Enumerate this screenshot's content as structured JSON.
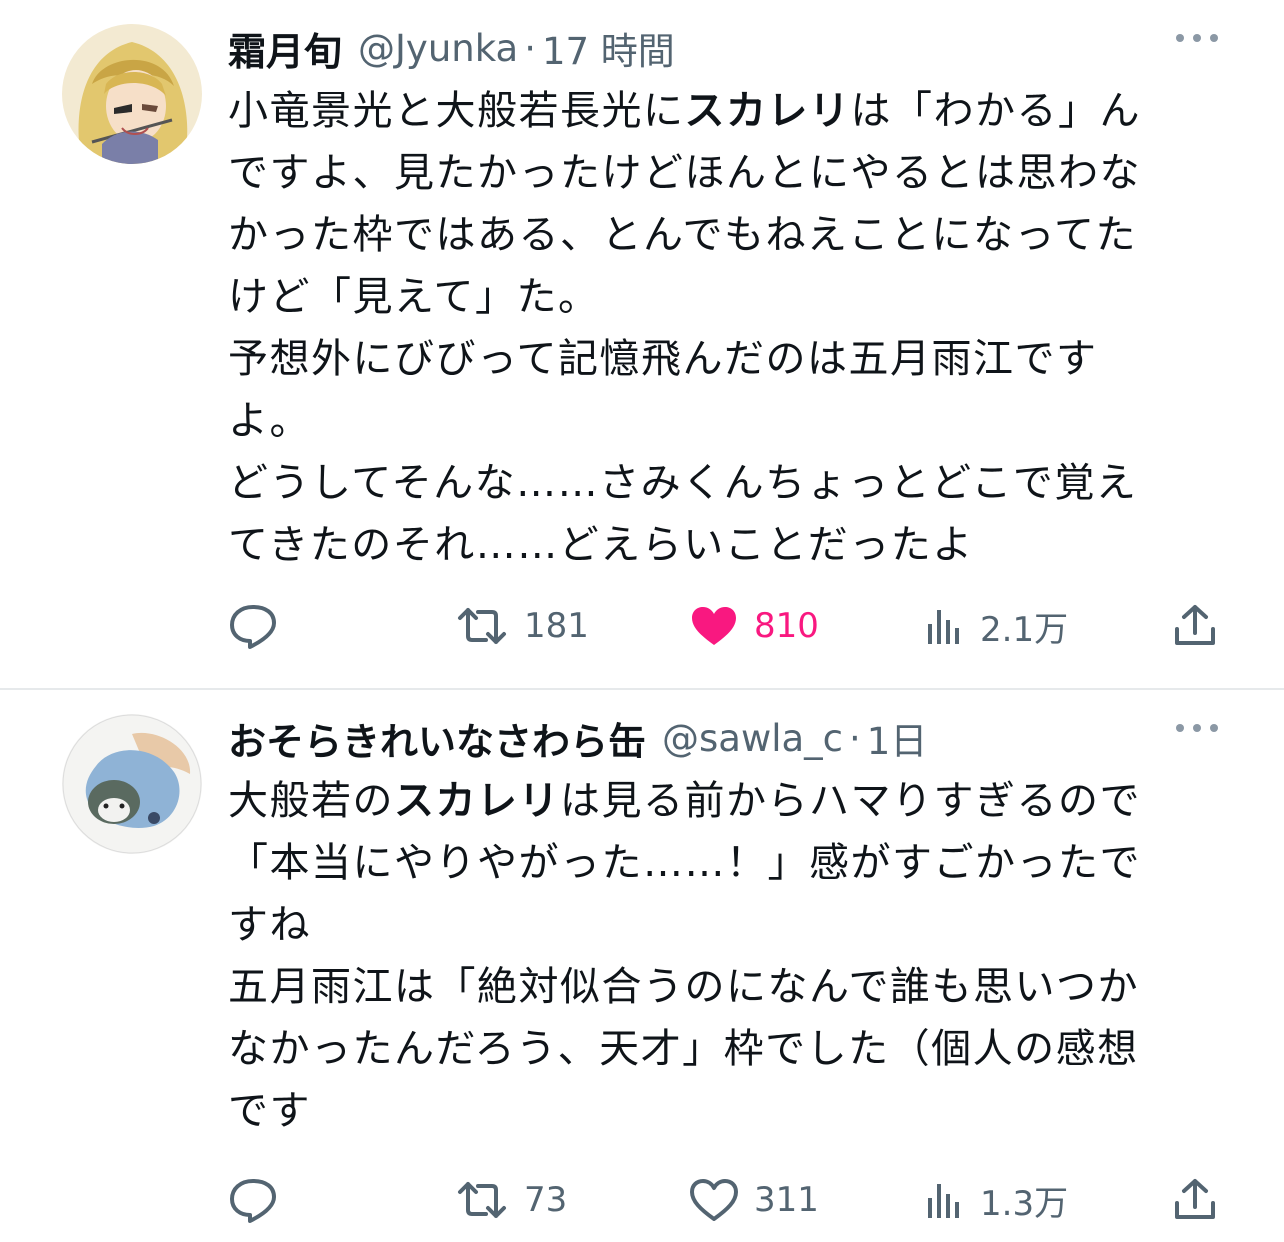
{
  "tweets": [
    {
      "name": "霜月旬",
      "handle": "@Jyunka",
      "separator": "·",
      "time": "17 時間",
      "lines": [
        [
          "小竜景光と大般若長光に",
          "スカレリ",
          "は「わかる」ん"
        ],
        [
          "ですよ、見たかったけどほんとにやるとは思わな"
        ],
        [
          "かった枠ではある、とんでもねえことになってた"
        ],
        [
          "けど「見えて」た。"
        ],
        [
          "予想外にびびって記憶飛んだのは五月雨江です"
        ],
        [
          "よ。"
        ],
        [
          "どうしてそんな……さみくんちょっとどこで覚え"
        ],
        [
          "てきたのそれ……どえらいことだったよ"
        ]
      ],
      "retweets": "181",
      "likes": "810",
      "liked": true,
      "views": "2.1万"
    },
    {
      "name": "おそらきれいなさわら缶",
      "handle": "@sawla_c",
      "separator": "·",
      "time": "1日",
      "lines": [
        [
          "大般若の",
          "スカレリ",
          "は見る前からハマりすぎるので"
        ],
        [
          "「本当にやりやがった……！」感がすごかったで"
        ],
        [
          "すね"
        ],
        [
          "五月雨江は「絶対似合うのになんで誰も思いつか"
        ],
        [
          "なかったんだろう、天才」枠でした（個人の感想"
        ],
        [
          "です"
        ]
      ],
      "retweets": "73",
      "likes": "311",
      "liked": false,
      "views": "1.3万"
    }
  ],
  "colors": {
    "text": "#0f1419",
    "secondary": "#536471",
    "like_active": "#f91880",
    "divider": "#e6e9eb"
  },
  "icons": [
    "reply-icon",
    "retweet-icon",
    "like-icon",
    "views-icon",
    "share-icon",
    "more-icon"
  ]
}
